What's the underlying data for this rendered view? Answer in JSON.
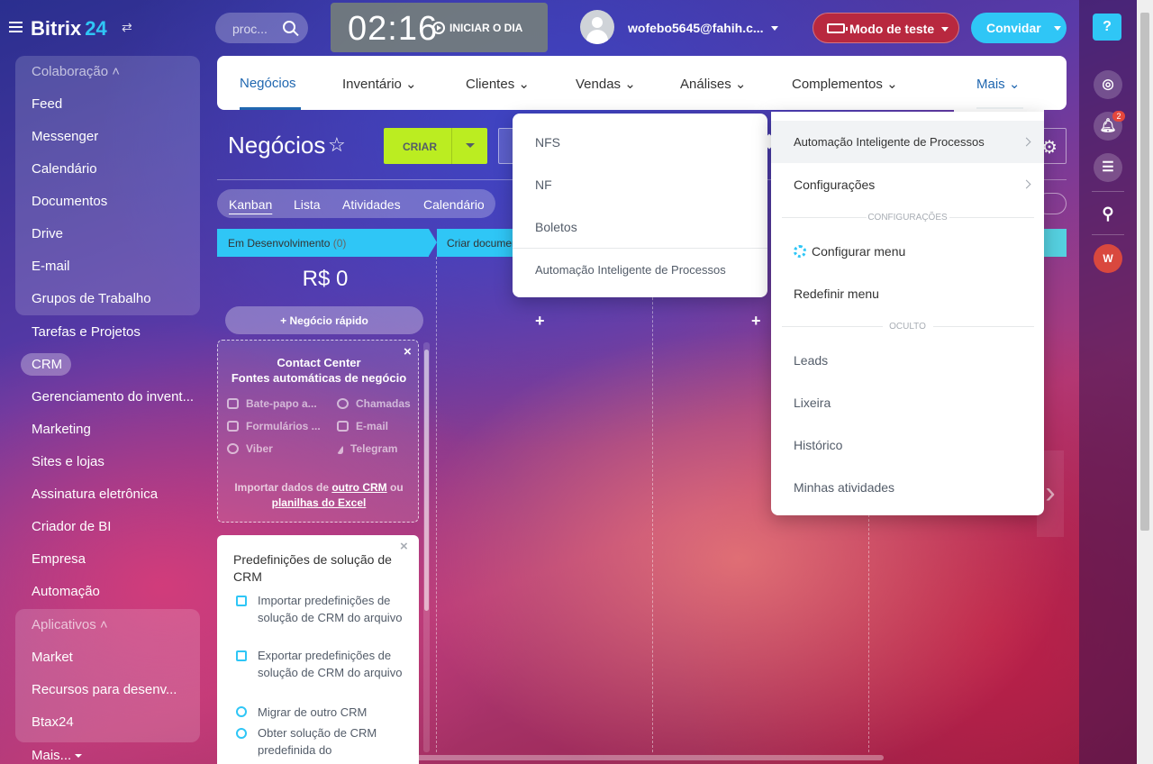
{
  "header": {
    "logo_text": "Bitrix",
    "logo_num": "24",
    "search_placeholder": "proc...",
    "clock_time": "02:16",
    "start_day": "INICIAR O DIA",
    "user_email": "wofebo5645@fahih.c...",
    "test_mode": "Modo de teste",
    "invite": "Convidar"
  },
  "right_rail": {
    "help": "?",
    "notifications_badge": "2",
    "user_initial": "W"
  },
  "sidebar": {
    "group1_title": "Colaboração",
    "group1_items": [
      "Feed",
      "Messenger",
      "Calendário",
      "Documentos",
      "Drive",
      "E-mail",
      "Grupos de Trabalho"
    ],
    "items": [
      "Tarefas e Projetos",
      "CRM",
      "Gerenciamento do invent...",
      "Marketing",
      "Sites e lojas",
      "Assinatura eletrônica",
      "Criador de BI",
      "Empresa",
      "Automação"
    ],
    "group2_title": "Aplicativos",
    "group2_items": [
      "Market",
      "Recursos para desenv...",
      "Btax24"
    ],
    "more": "Mais..."
  },
  "tabs": [
    "Negócios",
    "Inventário",
    "Clientes",
    "Vendas",
    "Análises",
    "Complementos",
    "Mais"
  ],
  "page": {
    "title": "Negócios",
    "create": "CRIAR",
    "views": [
      "Kanban",
      "Lista",
      "Atividades",
      "Calendário"
    ]
  },
  "kanban": {
    "stage1_name": "Em Desenvolvimento",
    "stage1_count": "(0)",
    "stage2_name": "Criar documentos",
    "sum": "R$ 0",
    "quick_deal": "Negócio rápido",
    "plus": "+"
  },
  "contact_center": {
    "title1": "Contact Center",
    "title2": "Fontes automáticas de negócio",
    "items": [
      "Bate-papo a...",
      "Chamadas",
      "Formulários ...",
      "E-mail",
      "Viber",
      "Telegram"
    ],
    "import_prefix": "Importar dados de ",
    "import_link1": "outro CRM",
    "import_mid": " ou",
    "import_link2": "planilhas do Excel",
    "close": "×"
  },
  "presets": {
    "title": "Predefinições de solução de CRM",
    "items": [
      "Importar predefinições de solução de CRM do arquivo",
      "Exportar predefinições de solução de CRM do arquivo",
      "Migrar de outro CRM",
      "Obter solução de CRM predefinida do"
    ],
    "close": "×"
  },
  "menu_submenu": {
    "items": [
      "NFS",
      "NF",
      "Boletos",
      "Automação Inteligente de Processos"
    ]
  },
  "menu_mais": {
    "items": [
      "Automação Inteligente de Processos",
      "Configurações"
    ],
    "section1": "CONFIGURAÇÕES",
    "settings_items": [
      "Configurar menu",
      "Redefinir menu"
    ],
    "section2": "OCULTO",
    "hidden_items": [
      "Leads",
      "Lixeira",
      "Histórico",
      "Minhas atividades"
    ]
  }
}
